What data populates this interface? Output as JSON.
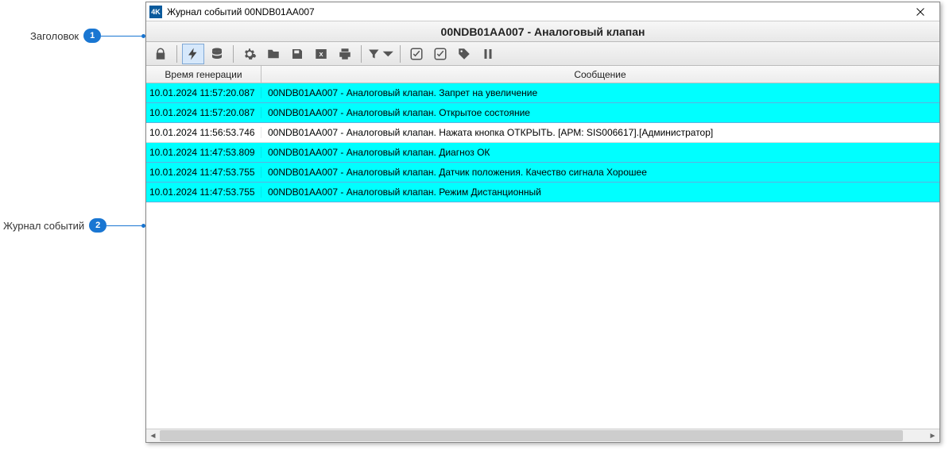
{
  "annotations": {
    "a1": {
      "label": "Заголовок",
      "num": "1"
    },
    "a2": {
      "label": "Журнал событий",
      "num": "2"
    }
  },
  "window": {
    "title": "Журнал событий 00NDB01AA007",
    "icon_text": "4K"
  },
  "header": {
    "text": "00NDB01AA007 - Аналоговый клапан"
  },
  "toolbar": {
    "icons": {
      "lock": "lock-icon",
      "bolt": "bolt-icon",
      "db": "database-icon",
      "gear": "gear-icon",
      "folder": "folder-icon",
      "save": "save-icon",
      "excel": "excel-icon",
      "print": "print-icon",
      "filter": "filter-icon",
      "check1": "check-icon",
      "check2": "check-all-icon",
      "tag": "tag-icon",
      "pause": "pause-icon"
    }
  },
  "table": {
    "columns": {
      "time": "Время генерации",
      "msg": "Сообщение"
    },
    "rows": [
      {
        "time": "10.01.2024 11:57:20.087",
        "msg": "00NDB01AA007 - Аналоговый клапан. Запрет на увеличение",
        "style": "cyan"
      },
      {
        "time": "10.01.2024 11:57:20.087",
        "msg": "00NDB01AA007 - Аналоговый клапан. Открытое состояние",
        "style": "cyan"
      },
      {
        "time": "10.01.2024 11:56:53.746",
        "msg": "00NDB01AA007 - Аналоговый клапан. Нажата кнопка ОТКРЫТЬ. [АРМ: SIS006617].[Администратор]",
        "style": "white"
      },
      {
        "time": "10.01.2024 11:47:53.809",
        "msg": "00NDB01AA007 - Аналоговый клапан. Диагноз ОК",
        "style": "cyan"
      },
      {
        "time": "10.01.2024 11:47:53.755",
        "msg": "00NDB01AA007 - Аналоговый клапан. Датчик положения. Качество сигнала Хорошее",
        "style": "cyan"
      },
      {
        "time": "10.01.2024 11:47:53.755",
        "msg": "00NDB01AA007 - Аналоговый клапан. Режим Дистанционный",
        "style": "cyan"
      }
    ]
  }
}
